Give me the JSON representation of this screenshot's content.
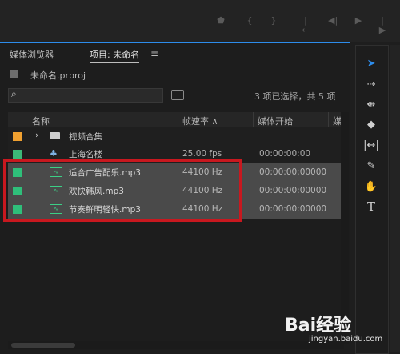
{
  "panel": {
    "tabs": [
      "媒体浏览器",
      "项目: 未命名"
    ],
    "menu_icon": "hamburger-icon"
  },
  "project": {
    "file_name": "未命名.prproj",
    "status": "3 项已选择，共 5 项"
  },
  "table": {
    "headers": [
      "名称",
      "帧速率 ∧",
      "媒体开始",
      "媒"
    ],
    "rows": [
      {
        "name": "视频合集",
        "fps": "",
        "start": "",
        "color": "#f0a030",
        "icon": "folder-icon",
        "expander": "›",
        "selected": false
      },
      {
        "name": "上海名楼",
        "fps": "25.00 fps",
        "start": "00:00:00:00",
        "color": "#3cb878",
        "icon": "sequence-icon",
        "expander": "",
        "selected": false
      },
      {
        "name": "适合广告配乐.mp3",
        "fps": "44100 Hz",
        "start": "00:00:00:00000",
        "color": "#2fbf7a",
        "icon": "audio-clip-icon",
        "expander": "",
        "selected": true
      },
      {
        "name": "欢快韩风.mp3",
        "fps": "44100 Hz",
        "start": "00:00:00:00000",
        "color": "#2fbf7a",
        "icon": "audio-clip-icon",
        "expander": "",
        "selected": true
      },
      {
        "name": "节奏鲜明轻快.mp3",
        "fps": "44100 Hz",
        "start": "00:00:00:00000",
        "color": "#2fbf7a",
        "icon": "audio-clip-icon",
        "expander": "",
        "selected": true
      }
    ]
  },
  "tools": [
    "selection-tool-icon",
    "track-select-icon",
    "ripple-edit-icon",
    "razor-tool-icon",
    "slip-tool-icon",
    "pen-tool-icon",
    "hand-tool-icon",
    "type-tool-icon"
  ],
  "watermark": {
    "text": "Bai经验",
    "url": "jingyan.baidu.com"
  }
}
